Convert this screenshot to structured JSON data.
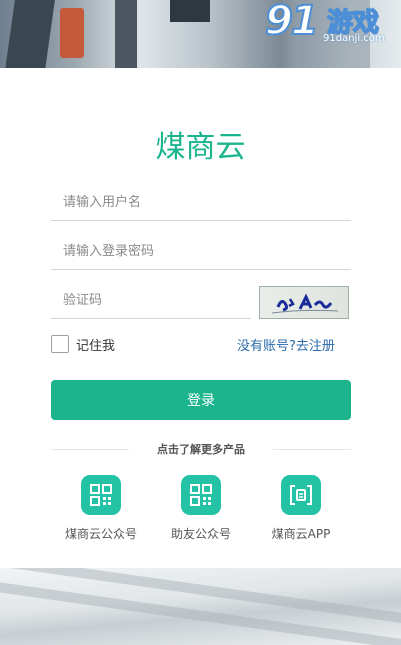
{
  "watermark": {
    "brand_number": "91",
    "brand_text": "游戏",
    "url": "91danji.com"
  },
  "app": {
    "title": "煤商云"
  },
  "form": {
    "username_placeholder": "请输入用户名",
    "password_placeholder": "请输入登录密码",
    "captcha_placeholder": "验证码",
    "captcha_icon": "captcha-image",
    "remember_label": "记住我",
    "register_link": "没有账号?去注册",
    "login_button": "登录"
  },
  "more_products": {
    "heading": "点击了解更多产品",
    "items": [
      {
        "label": "煤商云公众号",
        "icon": "qr-code-icon"
      },
      {
        "label": "助友公众号",
        "icon": "qr-code-icon"
      },
      {
        "label": "煤商云APP",
        "icon": "app-scan-icon"
      }
    ]
  },
  "colors": {
    "accent": "#1bb48c",
    "icon_tile": "#23c2a5",
    "link": "#2b6cab",
    "watermark_blue": "#4d8fd6"
  }
}
